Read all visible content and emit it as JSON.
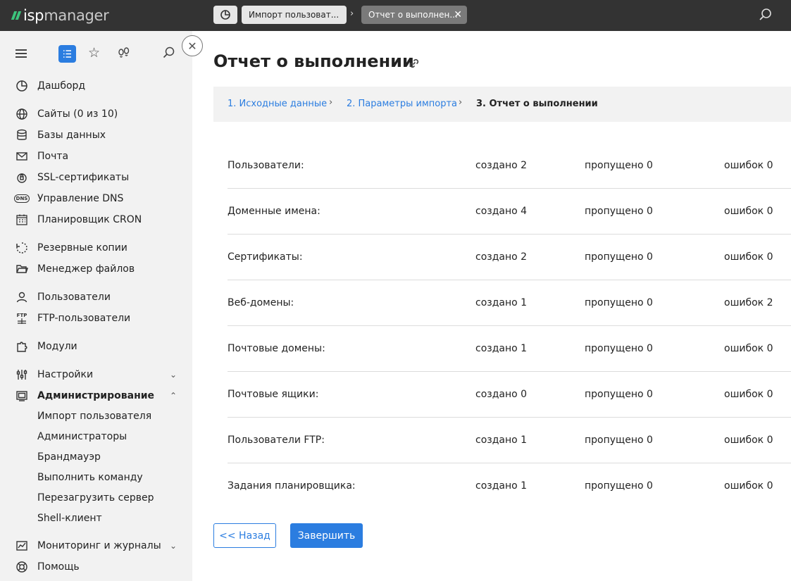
{
  "app": {
    "logo_isp": "isp",
    "logo_manager": "manager"
  },
  "topbar": {
    "tab1_label": "Импорт пользоват...",
    "separator": "›",
    "tab2_label": "Отчет о выполнен...",
    "close_glyph": "✕"
  },
  "sidebar": {
    "collapse_glyph": "✕",
    "star_glyph": "☆",
    "items": [
      {
        "label": "Дашборд",
        "icon": "dashboard-icon"
      },
      {
        "label": "Сайты (0 из 10)",
        "icon": "globe-icon"
      },
      {
        "label": "Базы данных",
        "icon": "database-icon"
      },
      {
        "label": "Почта",
        "icon": "mail-icon"
      },
      {
        "label": "SSL-сертификаты",
        "icon": "lock-icon"
      },
      {
        "label": "Управление DNS",
        "icon": "dns-icon"
      },
      {
        "label": "Планировщик CRON",
        "icon": "calendar-icon"
      },
      {
        "label": "Резервные копии",
        "icon": "backup-icon"
      },
      {
        "label": "Менеджер файлов",
        "icon": "folder-icon"
      },
      {
        "label": "Пользователи",
        "icon": "user-icon"
      },
      {
        "label": "FTP-пользователи",
        "icon": "ftp-icon"
      },
      {
        "label": "Модули",
        "icon": "puzzle-icon"
      },
      {
        "label": "Настройки",
        "icon": "sliders-icon"
      },
      {
        "label": "Администрирование",
        "icon": "admin-icon"
      },
      {
        "label": "Мониторинг и журналы",
        "icon": "monitoring-icon"
      },
      {
        "label": "Помощь",
        "icon": "help-icon"
      }
    ],
    "dns_icon_text": "DNS",
    "ftp_icon_text": "FTP",
    "chevron_down": "⌄",
    "chevron_up": "⌃",
    "admin_sub": [
      "Импорт пользователя",
      "Администраторы",
      "Брандмауэр",
      "Выполнить команду",
      "Перезагрузить сервер",
      "Shell-клиент"
    ]
  },
  "main": {
    "title": "Отчет о выполнении",
    "breadcrumbs": [
      "1. Исходные данные",
      "2. Параметры импорта",
      "3. Отчет о выполнении"
    ],
    "crumb_sep": "›",
    "rows": [
      {
        "name": "Пользователи:",
        "created": "создано 2",
        "skipped": "пропущено 0",
        "errors": "ошибок 0"
      },
      {
        "name": "Доменные имена:",
        "created": "создано 4",
        "skipped": "пропущено 0",
        "errors": "ошибок 0"
      },
      {
        "name": "Сертификаты:",
        "created": "создано 2",
        "skipped": "пропущено 0",
        "errors": "ошибок 0"
      },
      {
        "name": "Веб-домены:",
        "created": "создано 1",
        "skipped": "пропущено 0",
        "errors": "ошибок 2"
      },
      {
        "name": "Почтовые домены:",
        "created": "создано 1",
        "skipped": "пропущено 0",
        "errors": "ошибок 0"
      },
      {
        "name": "Почтовые ящики:",
        "created": "создано 0",
        "skipped": "пропущено 0",
        "errors": "ошибок 0"
      },
      {
        "name": "Пользователи FTP:",
        "created": "создано 1",
        "skipped": "пропущено 0",
        "errors": "ошибок 0"
      },
      {
        "name": "Задания планировщика:",
        "created": "создано 1",
        "skipped": "пропущено 0",
        "errors": "ошибок 0"
      }
    ],
    "back_label": "<< Назад",
    "finish_label": "Завершить"
  },
  "colors": {
    "accent": "#2b7de0",
    "topbar": "#333333",
    "sidebar": "#f2f2f2",
    "logo_green": "#3cc47c"
  }
}
